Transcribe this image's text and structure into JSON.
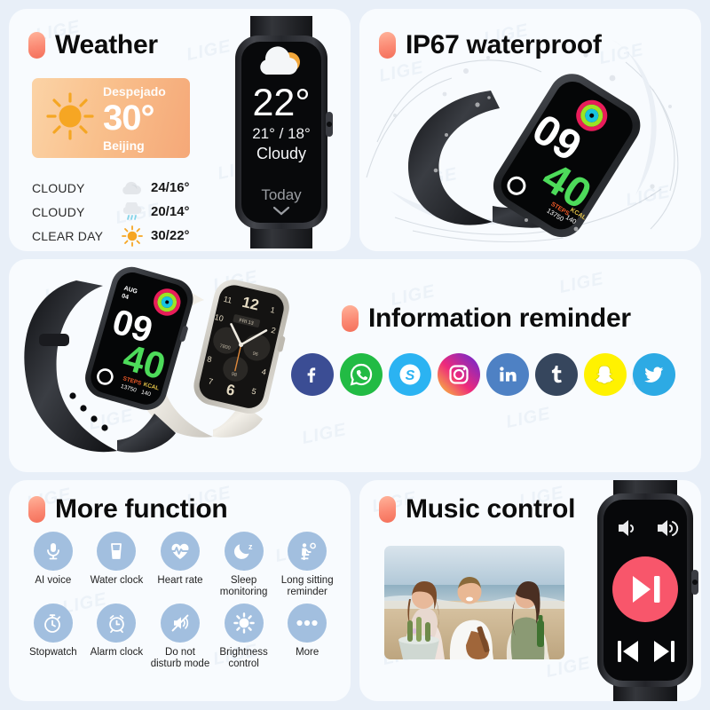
{
  "theme": {
    "page_bg": "#e8eff8",
    "panel_bg": "#f8fbfe",
    "bullet_color": "#f4705a",
    "function_icon_bg": "#a2bfdf",
    "music_button_color": "#f8566b",
    "watchface_accent_green": "#4ddb5a"
  },
  "watermark": "LIGE",
  "panels": {
    "weather": {
      "title": "Weather",
      "card": {
        "condition": "Despejado",
        "temperature": "30°",
        "city": "Beijing",
        "icon": "sun-icon"
      },
      "forecast_columns": [
        "condition",
        "icon",
        "temps"
      ],
      "forecast": [
        {
          "condition": "CLOUDY",
          "icon": "cloud-icon",
          "temps": "24/16°"
        },
        {
          "condition": "CLOUDY",
          "icon": "rain-cloud-icon",
          "temps": "20/14°"
        },
        {
          "condition": "CLEAR DAY",
          "icon": "sun-icon",
          "temps": "30/22°"
        }
      ],
      "watch_screen": {
        "icon": "partly-cloudy-icon",
        "temperature": "22°",
        "range": "21° / 18°",
        "condition": "Cloudy",
        "footer": "Today",
        "chevron": "chevron-down-icon"
      }
    },
    "ip67": {
      "title": "IP67 waterproof",
      "watch_screen": {
        "hours": "09",
        "minutes": "40",
        "steps_label": "STEPS",
        "steps_value": "13750",
        "kcal_label": "KCAL",
        "kcal_value": "140"
      }
    },
    "info": {
      "title": "Information reminder",
      "apps": [
        {
          "name": "facebook",
          "label": "f",
          "color": "#3b4d94"
        },
        {
          "name": "whatsapp",
          "label": "",
          "color": "#22bb44"
        },
        {
          "name": "skype",
          "label": "S",
          "color": "#2bb3f2"
        },
        {
          "name": "instagram",
          "label": "",
          "color": "#d6249f"
        },
        {
          "name": "linkedin",
          "label": "in",
          "color": "#4e81c4"
        },
        {
          "name": "tumblr",
          "label": "t",
          "color": "#36465d"
        },
        {
          "name": "snapchat",
          "label": "",
          "color": "#fff200"
        },
        {
          "name": "twitter",
          "label": "",
          "color": "#2daae4"
        }
      ],
      "watch_black": {
        "date_line1": "AUG",
        "date_line2": "04",
        "hours": "09",
        "minutes": "40",
        "steps_label": "STEPS",
        "steps_value": "13750",
        "kcal_label": "KCAL",
        "kcal_value": "140"
      },
      "watch_white": {
        "numerals": [
          "12",
          "1",
          "2",
          "4",
          "5",
          "6",
          "7",
          "8",
          "10",
          "11"
        ],
        "subdial_day": "FRI 13",
        "subdial_left": "7800",
        "subdial_right": "96",
        "subdial_bottom": "98"
      }
    },
    "more": {
      "title": "More function",
      "functions": [
        {
          "label": "AI voice",
          "icon": "microphone-icon"
        },
        {
          "label": "Water clock",
          "icon": "water-glass-icon"
        },
        {
          "label": "Heart rate",
          "icon": "heart-pulse-icon"
        },
        {
          "label": "Sleep monitoring",
          "icon": "moon-sleep-icon"
        },
        {
          "label": "Long sitting reminder",
          "icon": "sitting-person-icon"
        },
        {
          "label": "Stopwatch",
          "icon": "stopwatch-icon"
        },
        {
          "label": "Alarm clock",
          "icon": "alarm-clock-icon"
        },
        {
          "label": "Do not disturb mode",
          "icon": "mute-speaker-icon"
        },
        {
          "label": "Brightness control",
          "icon": "brightness-sun-icon"
        },
        {
          "label": "More",
          "icon": "ellipsis-icon"
        }
      ]
    },
    "music": {
      "title": "Music control",
      "photo_alt": "three friends on beach",
      "controls": [
        {
          "name": "volume-down-icon"
        },
        {
          "name": "volume-up-icon"
        },
        {
          "name": "play-pause-button"
        },
        {
          "name": "previous-track-button"
        },
        {
          "name": "next-track-button"
        }
      ]
    }
  }
}
